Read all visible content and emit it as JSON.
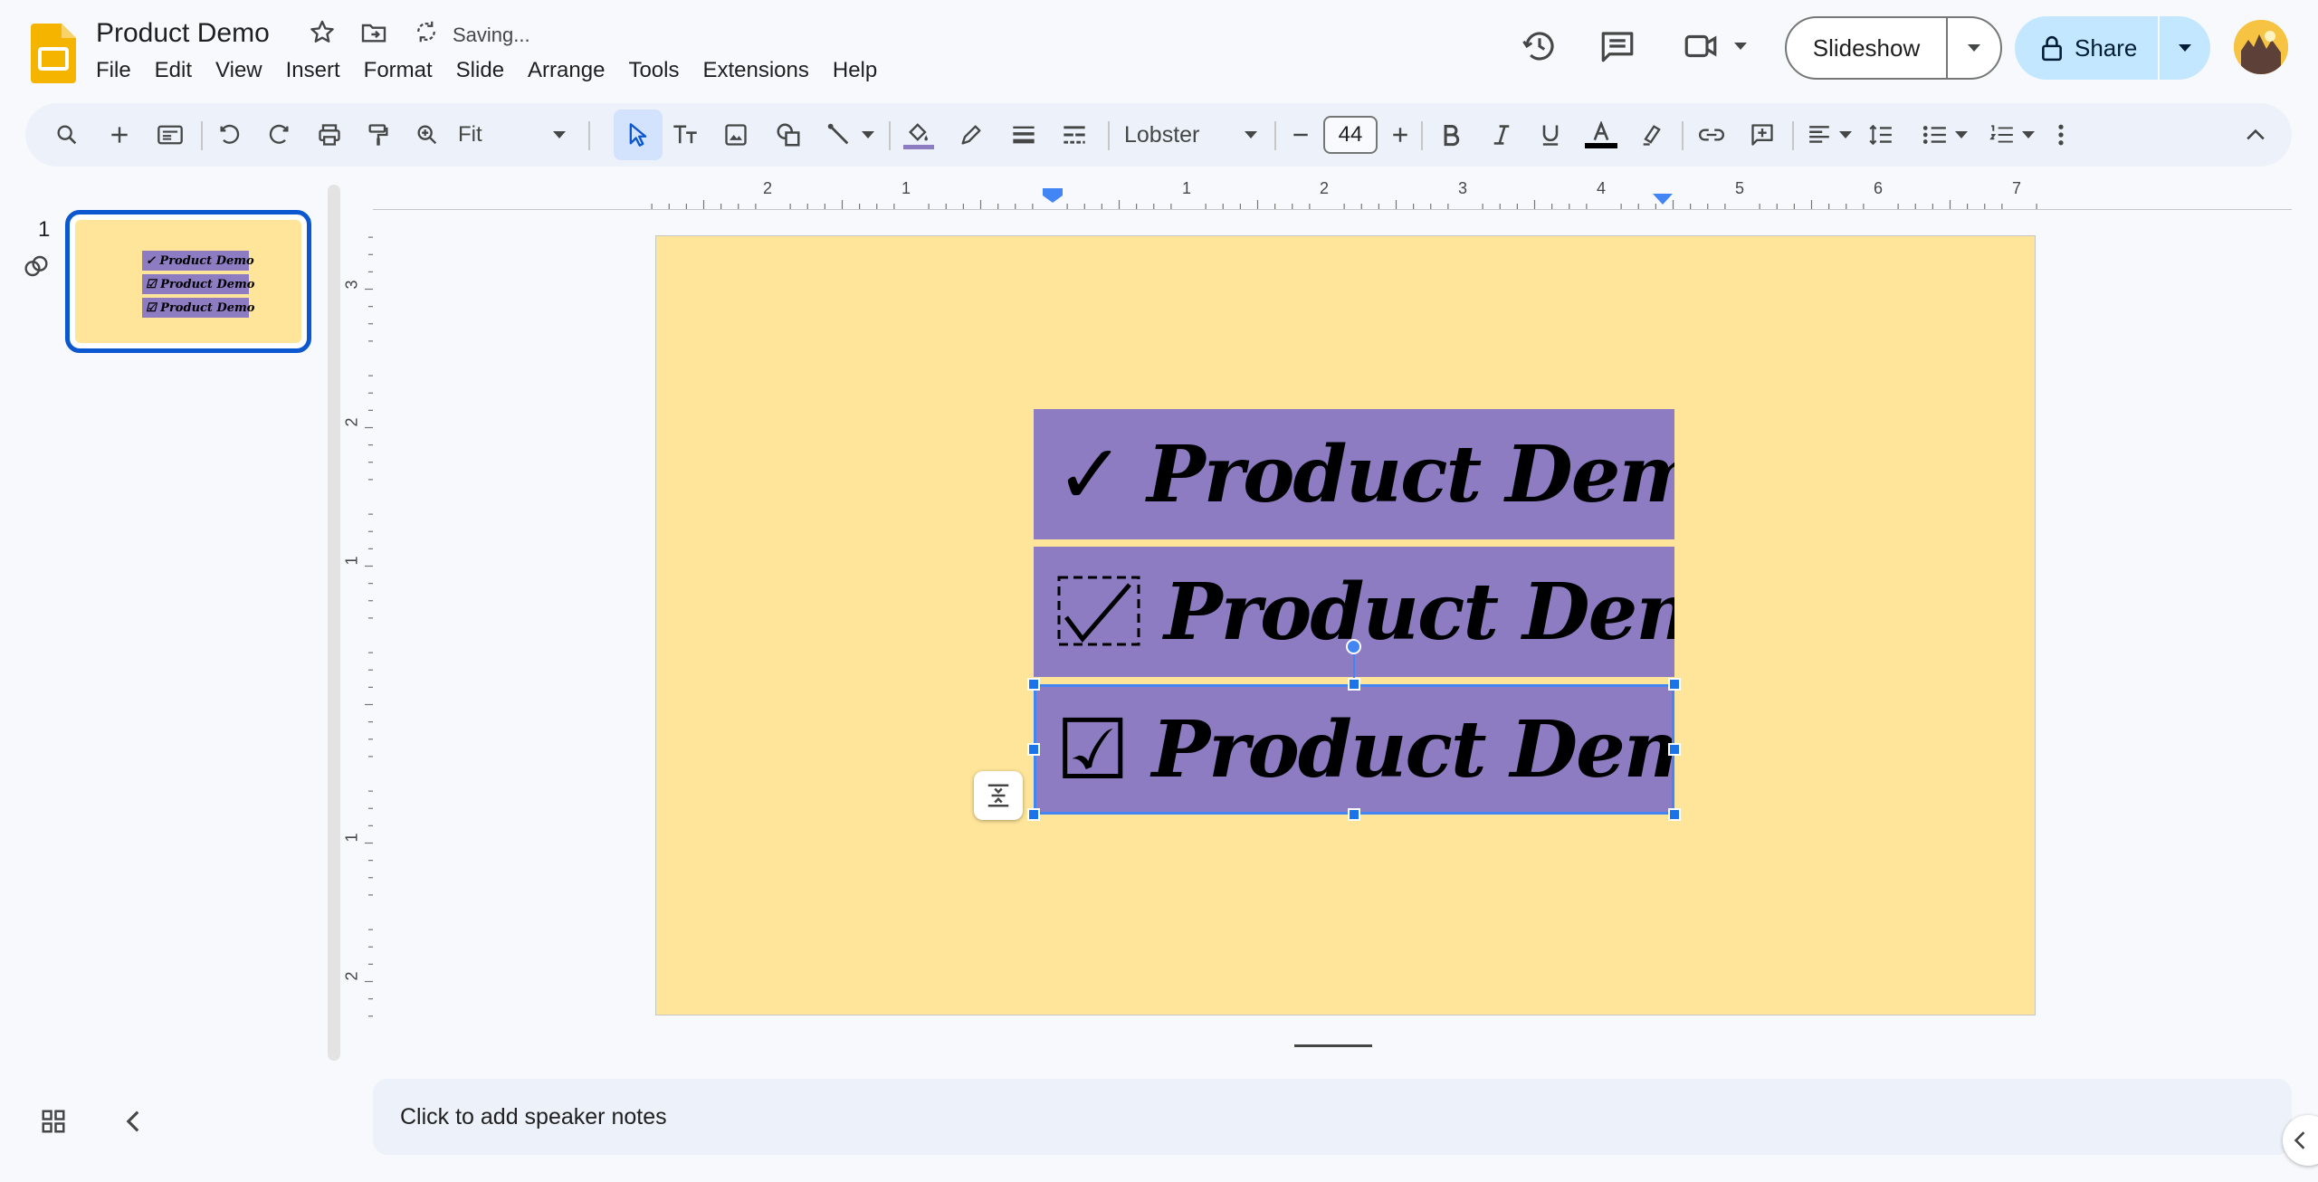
{
  "app": {
    "title": "Product Demo",
    "status": "Saving..."
  },
  "menu": [
    "File",
    "Edit",
    "View",
    "Insert",
    "Format",
    "Slide",
    "Arrange",
    "Tools",
    "Extensions",
    "Help"
  ],
  "header": {
    "slideshow_label": "Slideshow",
    "share_label": "Share"
  },
  "toolbar": {
    "zoom": "Fit",
    "font": "Lobster",
    "font_size": "44"
  },
  "filmstrip": {
    "slide_number": "1",
    "thumb_lines": [
      "✓ Product Demo",
      "☑ Product Demo",
      "☑ Product Demo"
    ]
  },
  "ruler": {
    "horizontal": [
      "2",
      "1",
      "1",
      "2",
      "3",
      "4",
      "5",
      "6",
      "7"
    ],
    "vertical": [
      "3",
      "2",
      "1",
      "1",
      "2"
    ]
  },
  "slide": {
    "background": "#ffe599",
    "box_color": "#8e7cc3",
    "boxes": [
      {
        "glyph": "✓",
        "text": "Product Demo"
      },
      {
        "glyph": "☑",
        "text": "Product Demo"
      },
      {
        "glyph": "☑",
        "text": "Product Demo"
      }
    ]
  },
  "notes": {
    "placeholder": "Click to add speaker notes"
  },
  "colors": {
    "accent": "#0b57d0",
    "share_bg": "#c2e7ff",
    "selection": "#4285f4",
    "fill_underline": "#8e7cc3"
  }
}
